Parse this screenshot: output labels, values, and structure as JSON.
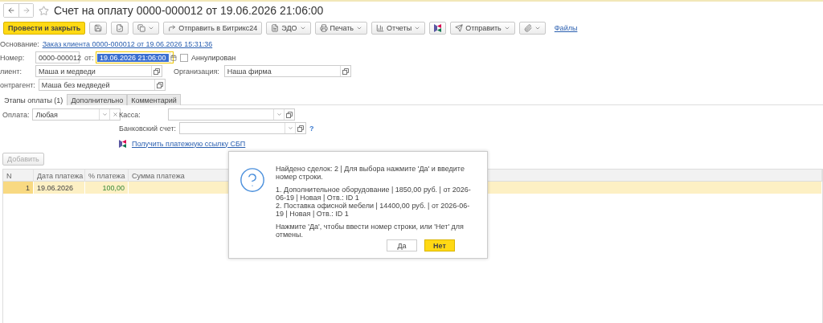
{
  "window": {
    "title": "Счет на оплату 0000-000012 от 19.06.2026 21:06:00",
    "favorite": false
  },
  "toolbar": [
    {
      "kind": "primary",
      "label": "Провести и закрыть"
    },
    {
      "kind": "icon",
      "dropdown": false
    },
    {
      "kind": "icon",
      "dropdown": false
    },
    {
      "kind": "icon",
      "dropdown": true
    },
    {
      "kind": "text",
      "label": "Отправить в Битрикс24",
      "dropdown": false
    },
    {
      "kind": "text",
      "label": "ЭДО",
      "dropdown": true
    },
    {
      "kind": "text",
      "label": "Печать",
      "dropdown": true
    },
    {
      "kind": "text",
      "label": "Отчеты",
      "dropdown": true
    },
    {
      "kind": "icon",
      "dropdown": false
    },
    {
      "kind": "text",
      "label": "Отправить",
      "dropdown": true
    },
    {
      "kind": "icon",
      "dropdown": true
    },
    {
      "kind": "link",
      "label": "Файлы"
    }
  ],
  "basis": {
    "label": "Основание:",
    "link": "Заказ клиента 0000-000012 от 19.06.2026 15:31:36"
  },
  "number": {
    "label": "Номер:",
    "value": "0000-000012",
    "date_label": "от:",
    "date": "19.06.2026 21:06:00"
  },
  "cancelled": {
    "label": "Аннулирован",
    "checked": false
  },
  "client": {
    "label": "лиент:",
    "value": "Маша и медведи"
  },
  "organization": {
    "label": "Организация:",
    "value": "Наша фирма"
  },
  "counterparty": {
    "label": "онтрагент:",
    "value": "Маша без медведей"
  },
  "tabs": [
    {
      "label": "Этапы оплаты (1)",
      "selected": true
    },
    {
      "label": "Дополнительно",
      "selected": false
    },
    {
      "label": "Комментарий",
      "selected": false
    }
  ],
  "payment": {
    "label": "Оплата:",
    "value": "Любая"
  },
  "cash": {
    "label": "Касса:"
  },
  "bank_account": {
    "label": "Банковский счет:",
    "help": "?"
  },
  "sbp_link": "Получить платежную ссылку СБП",
  "add_button": {
    "label": "Добавить",
    "disabled": true
  },
  "table": {
    "columns": [
      "N",
      "Дата платежа",
      "% платежа",
      "Сумма платежа"
    ],
    "rows": [
      {
        "n": "1",
        "date": "19.06.2026",
        "percent": "100,00",
        "selected": true
      }
    ]
  },
  "dialog": {
    "message": "Найдено сделок: 2 | Для выбора нажмите 'Да' и введите номер строки.",
    "lines": [
      "1. Дополнительное оборудование | 1850,00 руб. | от 2026-06-19 | Новая | Отв.: ID 1",
      "2. Поставка офисной мебели | 14400,00 руб. | от 2026-06-19 | Новая | Отв.: ID 1"
    ],
    "prompt": "Нажмите 'Да', чтобы ввести номер строки, или 'Нет' для отмены.",
    "buttons": [
      {
        "label": "Да",
        "default": false
      },
      {
        "label": "Нет",
        "default": true
      }
    ]
  }
}
